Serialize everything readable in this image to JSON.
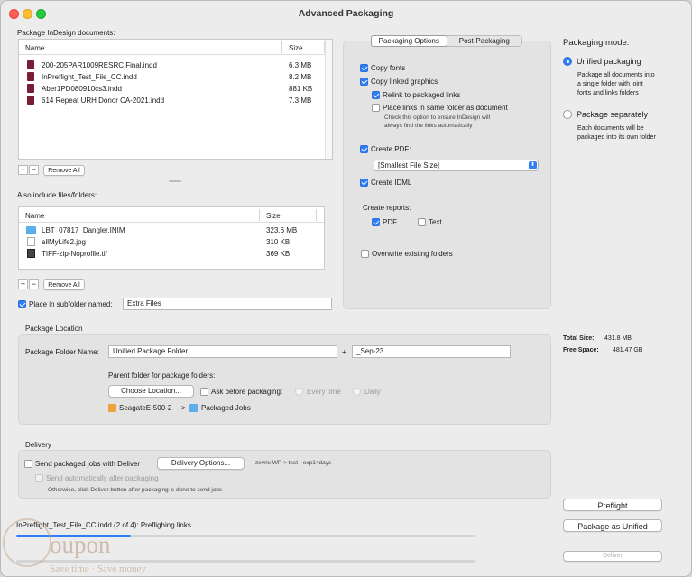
{
  "window": {
    "title": "Advanced Packaging"
  },
  "colors": {
    "accent": "#2f7ef6",
    "indd_icon": "#7a1e35",
    "folder_icon": "#5aaeea"
  },
  "documents": {
    "section_label": "Package InDesign documents:",
    "col_name": "Name",
    "col_size": "Size",
    "rows": [
      {
        "name": "200-205PAR1009RESRC.Final.indd",
        "size": "6.3 MB"
      },
      {
        "name": "InPreflight_Test_File_CC.indd",
        "size": "8.2 MB"
      },
      {
        "name": "Aber1PD080910cs3.indd",
        "size": "881 KB"
      },
      {
        "name": "614 Repeat URH Donor CA-2021.indd",
        "size": "7.3 MB"
      }
    ],
    "add": "+",
    "remove": "−",
    "remove_all": "Remove All"
  },
  "extras": {
    "section_label": "Also include files/folders:",
    "col_name": "Name",
    "col_size": "Size",
    "rows": [
      {
        "name": "LBT_07817_Dangler.INIM",
        "size": "323.6 MB",
        "icon": "folder-icon"
      },
      {
        "name": "allMyLife2.jpg",
        "size": "310 KB",
        "icon": "image-icon"
      },
      {
        "name": "TIFF-zip-Noprofile.tif",
        "size": "369 KB",
        "icon": "tiff-icon"
      }
    ],
    "add": "+",
    "remove": "−",
    "remove_all": "Remove All",
    "subfolder_label": "Place in subfolder named:",
    "subfolder_value": "Extra Files"
  },
  "options": {
    "tab_packaging": "Packaging Options",
    "tab_post": "Post-Packaging",
    "copy_fonts": "Copy fonts",
    "copy_graphics": "Copy linked graphics",
    "relink": "Relink to packaged links",
    "place_links": "Place links in same folder as document",
    "place_links_note1": "Check this option to ensure InDesign will",
    "place_links_note2": "always find the links automatically",
    "create_pdf": "Create PDF:",
    "pdf_preset": "[Smallest File Size]",
    "create_idml": "Create IDML",
    "create_reports": "Create reports:",
    "report_pdf": "PDF",
    "report_text": "Text",
    "overwrite": "Overwrite existing folders"
  },
  "mode": {
    "title": "Packaging mode:",
    "unified": "Unified packaging",
    "unified_desc1": "Package all documents into",
    "unified_desc2": "a single folder with joint",
    "unified_desc3": "fonts and links folders",
    "separately": "Package separately",
    "separately_desc1": "Each documents will be",
    "separately_desc2": "packaged into its own folder"
  },
  "stats": {
    "total_size_label": "Total Size:",
    "total_size": "431.8 MB",
    "free_space_label": "Free Space:",
    "free_space": "481.47 GB"
  },
  "location": {
    "section_label": "Package Location",
    "folder_name_label": "Package Folder Name:",
    "folder_name": "Unified Package Folder",
    "plus": "+",
    "suffix": "_Sep-23",
    "parent_label": "Parent folder for package folders:",
    "choose": "Choose Location...",
    "ask": "Ask before packaging:",
    "every_time": "Every time",
    "daily": "Daily",
    "drive": "SeagateE-500-2",
    "sep": ">",
    "folder": "Packaged Jobs"
  },
  "delivery": {
    "section_label": "Delivery",
    "send": "Send packaged jobs with Deliver",
    "options_btn": "Delivery Options...",
    "path": "zevrix WP > test - exp14days",
    "auto": "Send automatically after packaging",
    "note": "Otherwise, click Deliver button after packaging is done to send jobs"
  },
  "actions": {
    "preflight": "Preflight",
    "package": "Package as Unified",
    "deliver": "Deliver"
  },
  "status": {
    "text": "InPreflight_Test_File_CC.indd (2 of 4): Preflighing links...",
    "progress": 0.25
  },
  "watermark": {
    "brand": "oupon",
    "tagline": "Save time · Save money"
  }
}
